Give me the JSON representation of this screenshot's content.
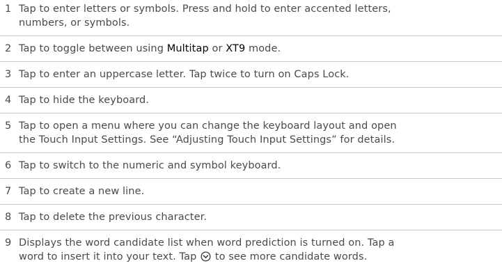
{
  "rows": [
    {
      "num": "1",
      "lines": [
        "Tap to enter letters or symbols. Press and hold to enter accented letters,",
        "numbers, or symbols."
      ]
    },
    {
      "num": "2",
      "parts": [
        "Tap to toggle between using ",
        "Multitap",
        " or ",
        "XT9",
        " mode."
      ]
    },
    {
      "num": "3",
      "text": "Tap to enter an uppercase letter. Tap twice to turn on Caps Lock."
    },
    {
      "num": "4",
      "text": "Tap to hide the keyboard."
    },
    {
      "num": "5",
      "lines": [
        "Tap to open a menu where you can change the keyboard layout and open",
        "the Touch Input Settings. See “Adjusting Touch Input Settings” for details."
      ]
    },
    {
      "num": "6",
      "text": "Tap to switch to the numeric and symbol keyboard."
    },
    {
      "num": "7",
      "text": "Tap to create a new line."
    },
    {
      "num": "8",
      "text": "Tap to delete the previous character."
    },
    {
      "num": "9",
      "line1": "Displays the word candidate list when word prediction is turned on. Tap a",
      "line2_before": "word to insert it into your text. Tap ",
      "icon": "chevron-down-circle-icon",
      "line2_after": " to see more candidate words."
    }
  ]
}
